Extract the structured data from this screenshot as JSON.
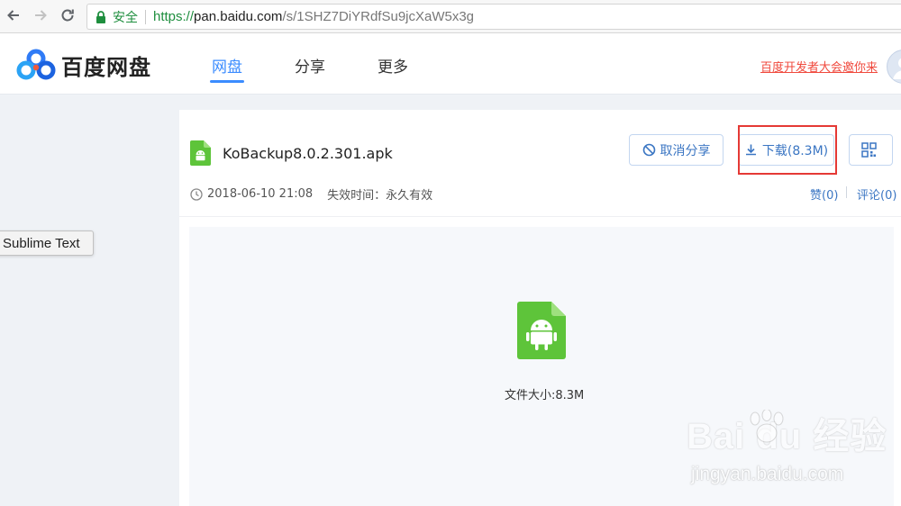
{
  "browser": {
    "secure_label": "安全",
    "url_scheme": "https://",
    "url_host": "pan.baidu.com",
    "url_path": "/s/1SHZ7DiYRdfSu9jcXaW5x3g",
    "back_icon": "arrow-left-icon",
    "forward_icon": "arrow-right-icon",
    "reload_icon": "reload-icon"
  },
  "header": {
    "logo_text": "百度网盘",
    "tabs": [
      {
        "label": "网盘",
        "active": true
      },
      {
        "label": "分享",
        "active": false
      },
      {
        "label": "更多",
        "active": false
      }
    ],
    "dev_link": "百度开发者大会邀你来",
    "accent_color": "#3b8cff"
  },
  "tooltip": {
    "text": "Sublime Text"
  },
  "file": {
    "name": "KoBackup8.0.2.301.apk",
    "date": "2018-06-10 21:08",
    "expire_label": "失效时间：",
    "expire_value": "永久有效",
    "size_text": "文件大小:8.3M",
    "icon": "android-apk-file-icon",
    "icon_color": "#5ec43a"
  },
  "actions": {
    "cancel_share": "取消分享",
    "download": "下载(8.3M)",
    "qr_icon": "qr-code-icon",
    "like": "赞(0)",
    "comment": "评论(0)"
  },
  "watermark": {
    "main": "Bai du 经验",
    "sub": "jingyan.baidu.com"
  }
}
